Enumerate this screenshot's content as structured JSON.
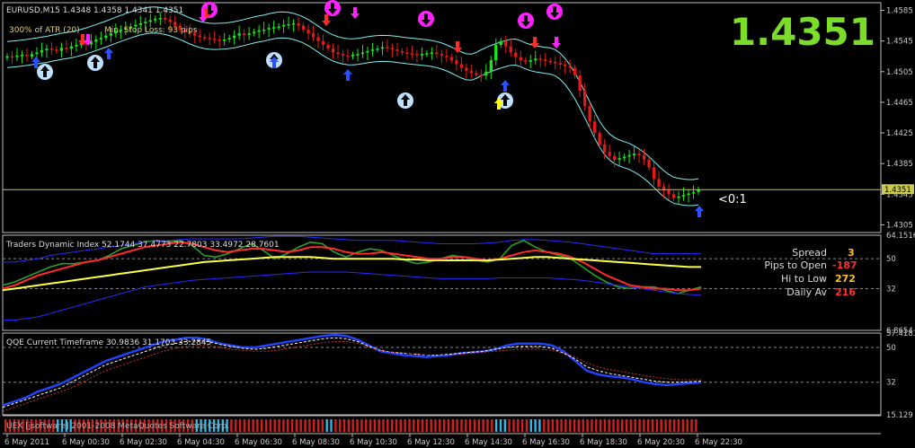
{
  "colors": {
    "background": "#000000",
    "frame": "#bdbdbd",
    "bull": "#19e619",
    "bear": "#e61919",
    "band": "#7ff0f0",
    "price_line": "#c9c94a",
    "big_price": "#7cdc2a",
    "tdi_green": "#2aa02a",
    "tdi_red": "#ff2a2a",
    "tdi_yellow": "#ffff40",
    "tdi_blue": "#2a2aff",
    "qqe_blue": "#2244ff",
    "qqe_white": "#ffffff",
    "qqe_red": "#c83030",
    "qqe_brown": "#a05020",
    "level_line": "#8a8a8a",
    "arrow_blue": "#2a50ff",
    "arrow_red": "#ff2a2a",
    "arrow_magenta": "#ff22ff",
    "arrow_yellow": "#ffff00",
    "circle_up": "#bde0ff",
    "circle_down": "#ff22ff",
    "text_label": "#dcdcdc",
    "value_orange": "#ffc020",
    "value_red": "#ff3030"
  },
  "header": {
    "symbol_line": "EURUSD,M15  1.4348 1.4358 1.4341 1.4351",
    "atr_line": "300% of ATR (20)",
    "stop_line": "Min. Stop Loss: 93 pips",
    "big_price": "1.4351",
    "countdown": "<0:1"
  },
  "info_box": [
    {
      "label": "Spread",
      "value": "3",
      "color": "#ffc020"
    },
    {
      "label": "Pips to Open",
      "value": "-187",
      "color": "#ff3030"
    },
    {
      "label": "Hi to Low",
      "value": "272",
      "color": "#ffc020"
    },
    {
      "label": "Daily Av",
      "value": "216",
      "color": "#ff3030"
    }
  ],
  "footer_text": "UEX [jsoftware] 2001-2008 MetaQuotes Software Corp.",
  "chart_data": [
    {
      "type": "candlestick",
      "title": "EURUSD,M15",
      "ohlc_last": {
        "open": 1.4348,
        "high": 1.4358,
        "low": 1.4341,
        "close": 1.4351
      },
      "ylim": [
        1.4295,
        1.4595
      ],
      "y_ticks": [
        "1.4585",
        "1.4545",
        "1.4505",
        "1.4465",
        "1.4425",
        "1.4385",
        "1.4345",
        "1.4305"
      ],
      "current_price_label": "1.4351",
      "x_ticks": [
        "6 May 2011",
        "6 May 00:30",
        "6 May 02:30",
        "6 May 04:30",
        "6 May 06:30",
        "6 May 08:30",
        "6 May 10:30",
        "6 May 12:30",
        "6 May 14:30",
        "6 May 16:30",
        "6 May 18:30",
        "6 May 20:30",
        "6 May 22:30"
      ],
      "close_path": [
        1.4525,
        1.4524,
        1.4526,
        1.4527,
        1.4525,
        1.4528,
        1.453,
        1.4533,
        1.4535,
        1.4534,
        1.4532,
        1.4536,
        1.4535,
        1.4538,
        1.454,
        1.4542,
        1.4541,
        1.4544,
        1.4547,
        1.4549,
        1.4552,
        1.4555,
        1.4558,
        1.456,
        1.4562,
        1.4564,
        1.4566,
        1.4568,
        1.457,
        1.4572,
        1.4574,
        1.4575,
        1.4573,
        1.457,
        1.4565,
        1.456,
        1.4557,
        1.4555,
        1.4552,
        1.455,
        1.4549,
        1.4548,
        1.4547,
        1.4546,
        1.4547,
        1.4549,
        1.4552,
        1.4555,
        1.4553,
        1.4555,
        1.4557,
        1.4559,
        1.456,
        1.4562,
        1.4563,
        1.4564,
        1.4566,
        1.4567,
        1.4568,
        1.4565,
        1.456,
        1.4555,
        1.455,
        1.4545,
        1.454,
        1.4535,
        1.453,
        1.4528,
        1.4526,
        1.4525,
        1.4527,
        1.4528,
        1.453,
        1.4532,
        1.4534,
        1.4535,
        1.4537,
        1.4536,
        1.4534,
        1.4532,
        1.453,
        1.4529,
        1.4528,
        1.4527,
        1.4528,
        1.4529,
        1.453,
        1.4528,
        1.4526,
        1.4524,
        1.452,
        1.4515,
        1.451,
        1.4506,
        1.4503,
        1.4501,
        1.45,
        1.4505,
        1.452,
        1.454,
        1.4545,
        1.4538,
        1.453,
        1.4524,
        1.452,
        1.4518,
        1.452,
        1.4522,
        1.4521,
        1.4519,
        1.4518,
        1.4516,
        1.4514,
        1.4512,
        1.451,
        1.45,
        1.448,
        1.446,
        1.444,
        1.4425,
        1.441,
        1.44,
        1.4395,
        1.439,
        1.4392,
        1.4394,
        1.4396,
        1.4398,
        1.4396,
        1.439,
        1.438,
        1.4365,
        1.4355,
        1.435,
        1.4345,
        1.434,
        1.4342,
        1.4344,
        1.4346,
        1.4348,
        1.4351
      ]
    },
    {
      "type": "line",
      "title": "Traders Dynamic Index 52.1744 37.4773 22.7803 33.4972 28.7601",
      "ylim": [
        6.8654,
        64.1516
      ],
      "y_ticks": [
        "64.1516",
        "50",
        "32",
        "6.8654"
      ],
      "levels": [
        50,
        32
      ],
      "series": [
        {
          "name": "green",
          "values": [
            34,
            36,
            39,
            42,
            45,
            47,
            47,
            48,
            49,
            52,
            56,
            58,
            60,
            61,
            60,
            61,
            58,
            52,
            51,
            53,
            56,
            59,
            55,
            50,
            53,
            57,
            60,
            59,
            54,
            51,
            54,
            56,
            55,
            52,
            49,
            47,
            48,
            50,
            52,
            51,
            49,
            48,
            50,
            58,
            61,
            57,
            54,
            52,
            50,
            45,
            40,
            36,
            33,
            32,
            33,
            33,
            31,
            29,
            31,
            33
          ]
        },
        {
          "name": "red",
          "values": [
            32,
            34,
            37,
            40,
            42,
            44,
            46,
            48,
            49,
            51,
            53,
            55,
            57,
            58,
            59,
            60,
            59,
            57,
            55,
            54,
            55,
            56,
            56,
            55,
            54,
            55,
            57,
            57,
            56,
            54,
            53,
            53,
            54,
            53,
            52,
            51,
            50,
            50,
            51,
            51,
            50,
            49,
            50,
            52,
            54,
            55,
            54,
            53,
            51,
            48,
            44,
            40,
            37,
            34,
            33,
            32,
            32,
            31,
            31,
            32
          ]
        },
        {
          "name": "yellow",
          "values": [
            31,
            32,
            33,
            34,
            35,
            36,
            37,
            38,
            39,
            40,
            41,
            42,
            43,
            44,
            45,
            46,
            47,
            48,
            48.5,
            49,
            49.5,
            50,
            50.5,
            51,
            51,
            51,
            51,
            50.5,
            50,
            50,
            50,
            50,
            50,
            50,
            49.5,
            49.5,
            49,
            49,
            49,
            49,
            49,
            49,
            49.5,
            50,
            50.5,
            51,
            51,
            50.5,
            50,
            49.5,
            49,
            48.5,
            48,
            47.5,
            47,
            46.5,
            46,
            45.5,
            45,
            45
          ]
        },
        {
          "name": "upper",
          "values": [
            48,
            48,
            49,
            50,
            52,
            53,
            54,
            55,
            56,
            57,
            58,
            59,
            60,
            60.5,
            61,
            61.5,
            62,
            62,
            62,
            62,
            62,
            62.5,
            63,
            63.5,
            63.5,
            63.5,
            63,
            62.5,
            62,
            61.5,
            61,
            61,
            61,
            61,
            60.5,
            60,
            59.5,
            59,
            59,
            59,
            59,
            59.5,
            60,
            61,
            61.5,
            61.5,
            61,
            60.5,
            60,
            59,
            58,
            57,
            56,
            55,
            54,
            53,
            53,
            53,
            53,
            53
          ]
        },
        {
          "name": "lower",
          "values": [
            13,
            13,
            14,
            15,
            17,
            19,
            21,
            23,
            25,
            27,
            29,
            31,
            33,
            34,
            35,
            36,
            37,
            37.5,
            38,
            38.5,
            39,
            39.5,
            40,
            40.5,
            41,
            41.5,
            42,
            42,
            42,
            42,
            41.5,
            41,
            40.5,
            40,
            39.5,
            39,
            38.5,
            38,
            38,
            38,
            38,
            38,
            38.5,
            38.5,
            38.5,
            38.5,
            38.5,
            38,
            37.5,
            37,
            36,
            35,
            34,
            33,
            32,
            31,
            30,
            29,
            28.5,
            28
          ]
        }
      ]
    },
    {
      "type": "line",
      "title": "QQE Current Timeframe 30.9836 31.1703 33.2845",
      "ylim": [
        15.129,
        57.4181
      ],
      "y_ticks": [
        "57.4181",
        "50",
        "32",
        "15.129"
      ],
      "levels": [
        50,
        32
      ],
      "series": [
        {
          "name": "blue",
          "values": [
            20,
            22,
            24,
            27,
            29,
            31,
            34,
            37,
            40,
            43,
            45,
            47,
            49,
            51,
            53,
            54,
            55,
            55,
            54,
            52,
            51,
            50,
            50,
            51,
            52,
            53,
            54,
            55,
            56,
            56.5,
            56,
            54,
            51,
            48,
            47,
            46,
            45.5,
            45,
            45.5,
            46,
            47,
            47.5,
            48,
            49,
            51,
            52,
            52,
            52,
            51,
            48,
            43,
            38,
            36,
            35,
            34.5,
            33.5,
            32,
            31,
            30.5,
            31,
            31.5,
            31.8
          ]
        },
        {
          "name": "white-dashed",
          "values": [
            19,
            21,
            23,
            25,
            27,
            29,
            32,
            35,
            38,
            41,
            43,
            45,
            47,
            49,
            51,
            52,
            53,
            53.5,
            53,
            51.5,
            50.5,
            49.5,
            49,
            49.5,
            50.5,
            51.5,
            52.5,
            53.5,
            54.5,
            55,
            54.5,
            53,
            50.5,
            48.5,
            47.5,
            47,
            46.5,
            46,
            46,
            46.5,
            47,
            47.5,
            48,
            49,
            50,
            50.5,
            50.5,
            50.5,
            49.5,
            47,
            44,
            40,
            38,
            36.5,
            35.5,
            34.5,
            33.5,
            32.5,
            32,
            32,
            32.2,
            32.5
          ]
        },
        {
          "name": "red-dotted",
          "values": [
            17,
            19,
            21,
            23,
            25,
            27,
            29,
            32,
            35,
            38,
            40,
            42,
            44,
            46,
            48,
            49.5,
            50.5,
            51,
            51,
            50,
            49,
            48.5,
            48,
            48,
            48.5,
            49.5,
            50.5,
            51.5,
            52.5,
            53,
            53,
            52,
            50,
            48.5,
            47.5,
            47,
            46.5,
            46,
            46,
            46,
            46.5,
            47,
            47.5,
            48,
            48.5,
            49,
            49,
            49,
            48.5,
            47,
            45,
            42,
            40,
            38.5,
            37.5,
            36.5,
            35.5,
            34.5,
            33.8,
            33.3,
            33.2,
            33.28
          ]
        }
      ]
    }
  ]
}
